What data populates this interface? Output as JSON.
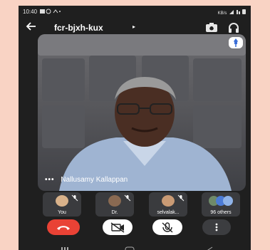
{
  "status_bar": {
    "time": "10:40",
    "right": "KB/s"
  },
  "header": {
    "meeting_code": "fcr-bjxh-kux",
    "caret": "▸"
  },
  "video": {
    "speaker_name": "Nallusamy Kallappan",
    "menu_dots": "•••"
  },
  "participants": [
    {
      "label": "You"
    },
    {
      "label": "Dr."
    },
    {
      "label": "selvalak..."
    },
    {
      "label": "96 others"
    }
  ],
  "colors": {
    "end_call": "#e94235",
    "background": "#f9d3c4",
    "app_bg": "#1f1f1f"
  },
  "icons": {
    "back": "arrow-left-icon",
    "switch_camera": "switch-camera-icon",
    "audio": "headphones-icon",
    "pin": "pin-icon",
    "end_call": "phone-hangup-icon",
    "camera_off": "camera-off-icon",
    "mic_off": "mic-off-icon",
    "more": "more-vertical-icon"
  }
}
